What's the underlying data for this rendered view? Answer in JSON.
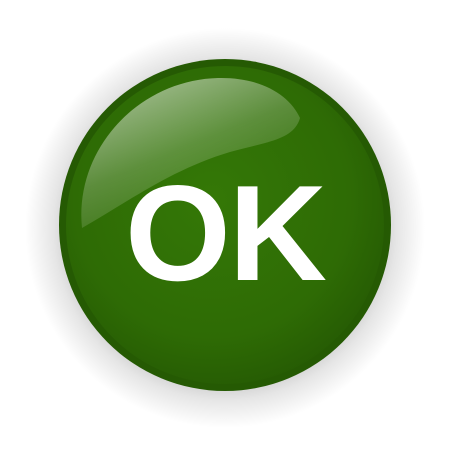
{
  "button": {
    "label": "OK",
    "colors": {
      "fill": "#2e6b05",
      "rim": "#255a03",
      "label": "#ffffff",
      "background": "#ffffff"
    }
  }
}
